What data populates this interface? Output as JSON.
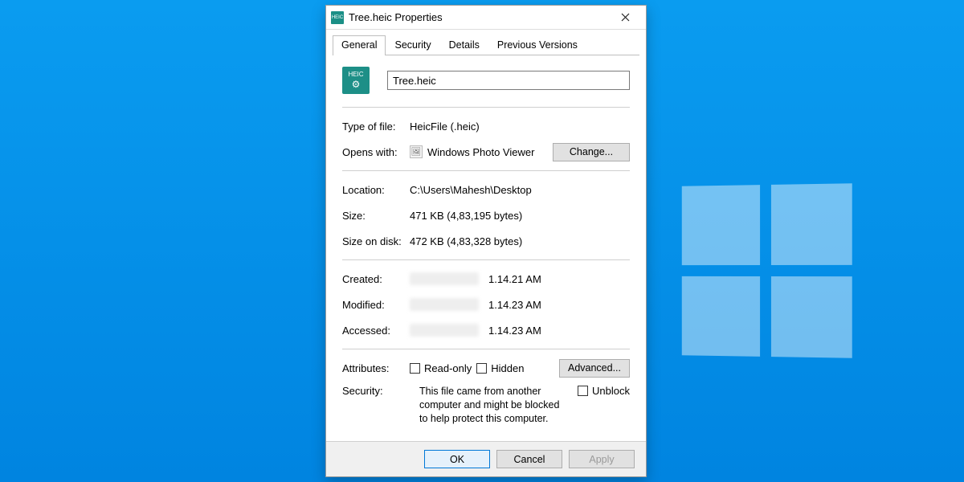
{
  "title": "Tree.heic Properties",
  "icon_label": "HEIC",
  "tabs": [
    "General",
    "Security",
    "Details",
    "Previous Versions"
  ],
  "active_tab": 0,
  "filename": "Tree.heic",
  "fields": {
    "type_label": "Type of file:",
    "type_value": "HeicFile (.heic)",
    "opens_label": "Opens with:",
    "opens_value": "Windows Photo Viewer",
    "change_btn": "Change...",
    "location_label": "Location:",
    "location_value": "C:\\Users\\Mahesh\\Desktop",
    "size_label": "Size:",
    "size_value": "471 KB (4,83,195 bytes)",
    "disk_label": "Size on disk:",
    "disk_value": "472 KB (4,83,328 bytes)",
    "created_label": "Created:",
    "created_time": "1.14.21 AM",
    "modified_label": "Modified:",
    "modified_time": "1.14.23 AM",
    "accessed_label": "Accessed:",
    "accessed_time": "1.14.23 AM",
    "attributes_label": "Attributes:",
    "readonly_label": "Read-only",
    "hidden_label": "Hidden",
    "advanced_btn": "Advanced...",
    "security_label": "Security:",
    "security_text": "This file came from another computer and might be blocked to help protect this computer.",
    "unblock_label": "Unblock"
  },
  "footer": {
    "ok": "OK",
    "cancel": "Cancel",
    "apply": "Apply"
  }
}
